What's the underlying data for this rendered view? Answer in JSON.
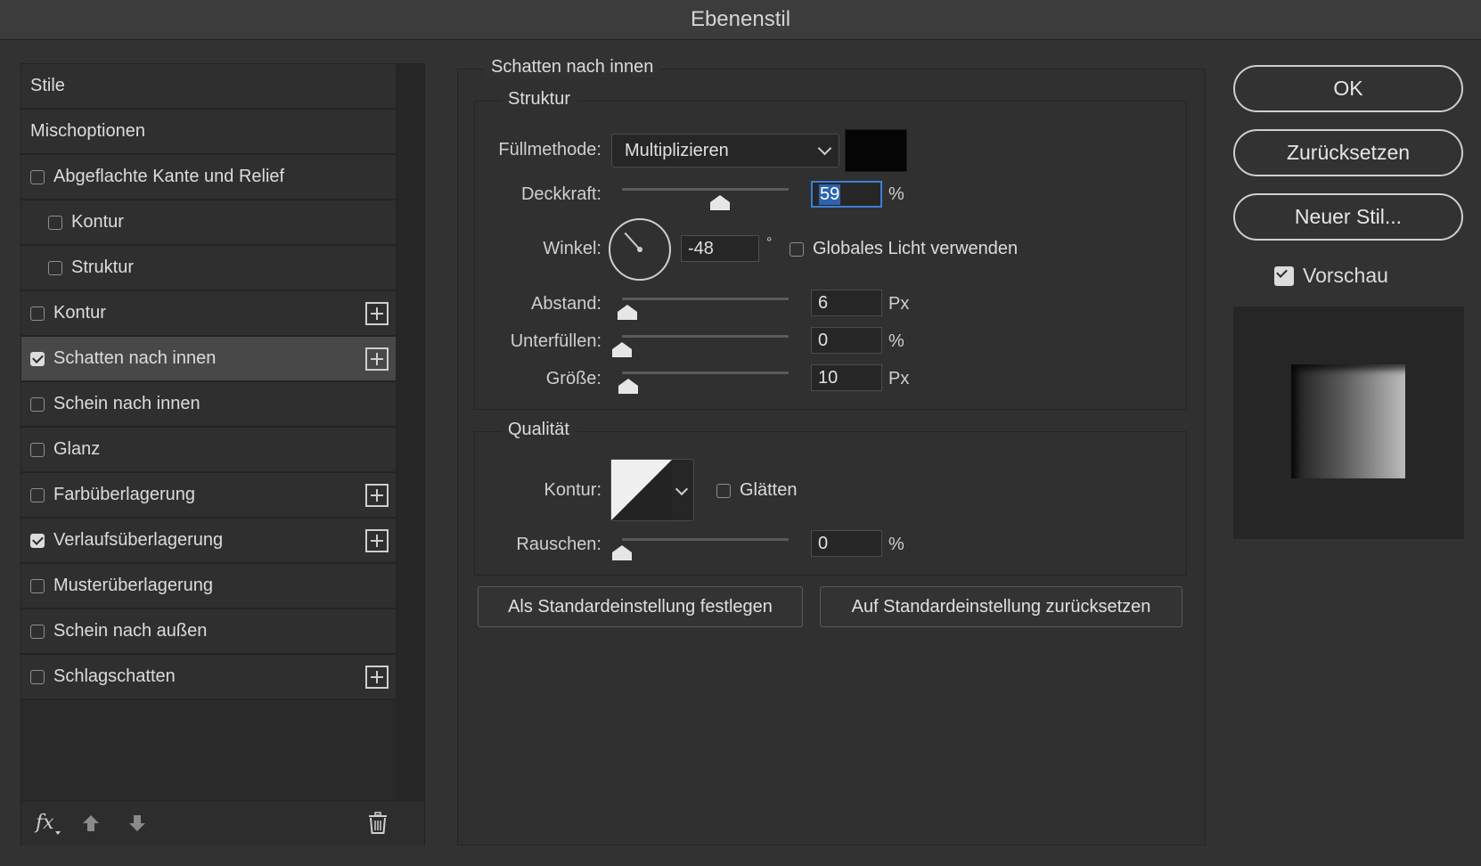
{
  "window": {
    "title": "Ebenenstil"
  },
  "styles": {
    "items": [
      {
        "label": "Stile",
        "type": "header"
      },
      {
        "label": "Mischoptionen",
        "type": "header"
      },
      {
        "label": "Abgeflachte Kante und Relief",
        "checked": false
      },
      {
        "label": "Kontur",
        "checked": false,
        "sub": true
      },
      {
        "label": "Struktur",
        "checked": false,
        "sub": true
      },
      {
        "label": "Kontur",
        "checked": false,
        "plus": true
      },
      {
        "label": "Schatten nach innen",
        "checked": true,
        "plus": true,
        "selected": true
      },
      {
        "label": "Schein nach innen",
        "checked": false
      },
      {
        "label": "Glanz",
        "checked": false
      },
      {
        "label": "Farbüberlagerung",
        "checked": false,
        "plus": true
      },
      {
        "label": "Verlaufsüberlagerung",
        "checked": true,
        "plus": true
      },
      {
        "label": "Musterüberlagerung",
        "checked": false
      },
      {
        "label": "Schein nach außen",
        "checked": false
      },
      {
        "label": "Schlagschatten",
        "checked": false,
        "plus": true
      }
    ],
    "footer_fx": "fx",
    "footer_icons": [
      "move-up-icon",
      "move-down-icon",
      "trash-icon"
    ]
  },
  "panel": {
    "title": "Schatten nach innen",
    "struktur": {
      "title": "Struktur",
      "blend_label": "Füllmethode:",
      "blend_value": "Multiplizieren",
      "shadow_color": "#050505",
      "opacity_label": "Deckkraft:",
      "opacity_value": "59",
      "opacity_unit": "%",
      "opacity_level": 0.59,
      "angle_label": "Winkel:",
      "angle_value": "-48",
      "angle_unit": "°",
      "angle_degrees": -48,
      "global_light_label": "Globales Licht verwenden",
      "global_light_checked": false,
      "distance_label": "Abstand:",
      "distance_value": "6",
      "distance_unit": "Px",
      "distance_level": 0.03,
      "choke_label": "Unterfüllen:",
      "choke_value": "0",
      "choke_unit": "%",
      "choke_level": 0,
      "size_label": "Größe:",
      "size_value": "10",
      "size_unit": "Px",
      "size_level": 0.04
    },
    "qualitaet": {
      "title": "Qualität",
      "contour_label": "Kontur:",
      "antialias_label": "Glätten",
      "antialias_checked": false,
      "noise_label": "Rauschen:",
      "noise_value": "0",
      "noise_unit": "%",
      "noise_level": 0
    },
    "set_default_label": "Als Standardeinstellung festlegen",
    "reset_default_label": "Auf Standardeinstellung zurücksetzen"
  },
  "actions": {
    "ok_label": "OK",
    "reset_label": "Zurücksetzen",
    "new_style_label": "Neuer Stil...",
    "preview_label": "Vorschau",
    "preview_checked": true
  }
}
